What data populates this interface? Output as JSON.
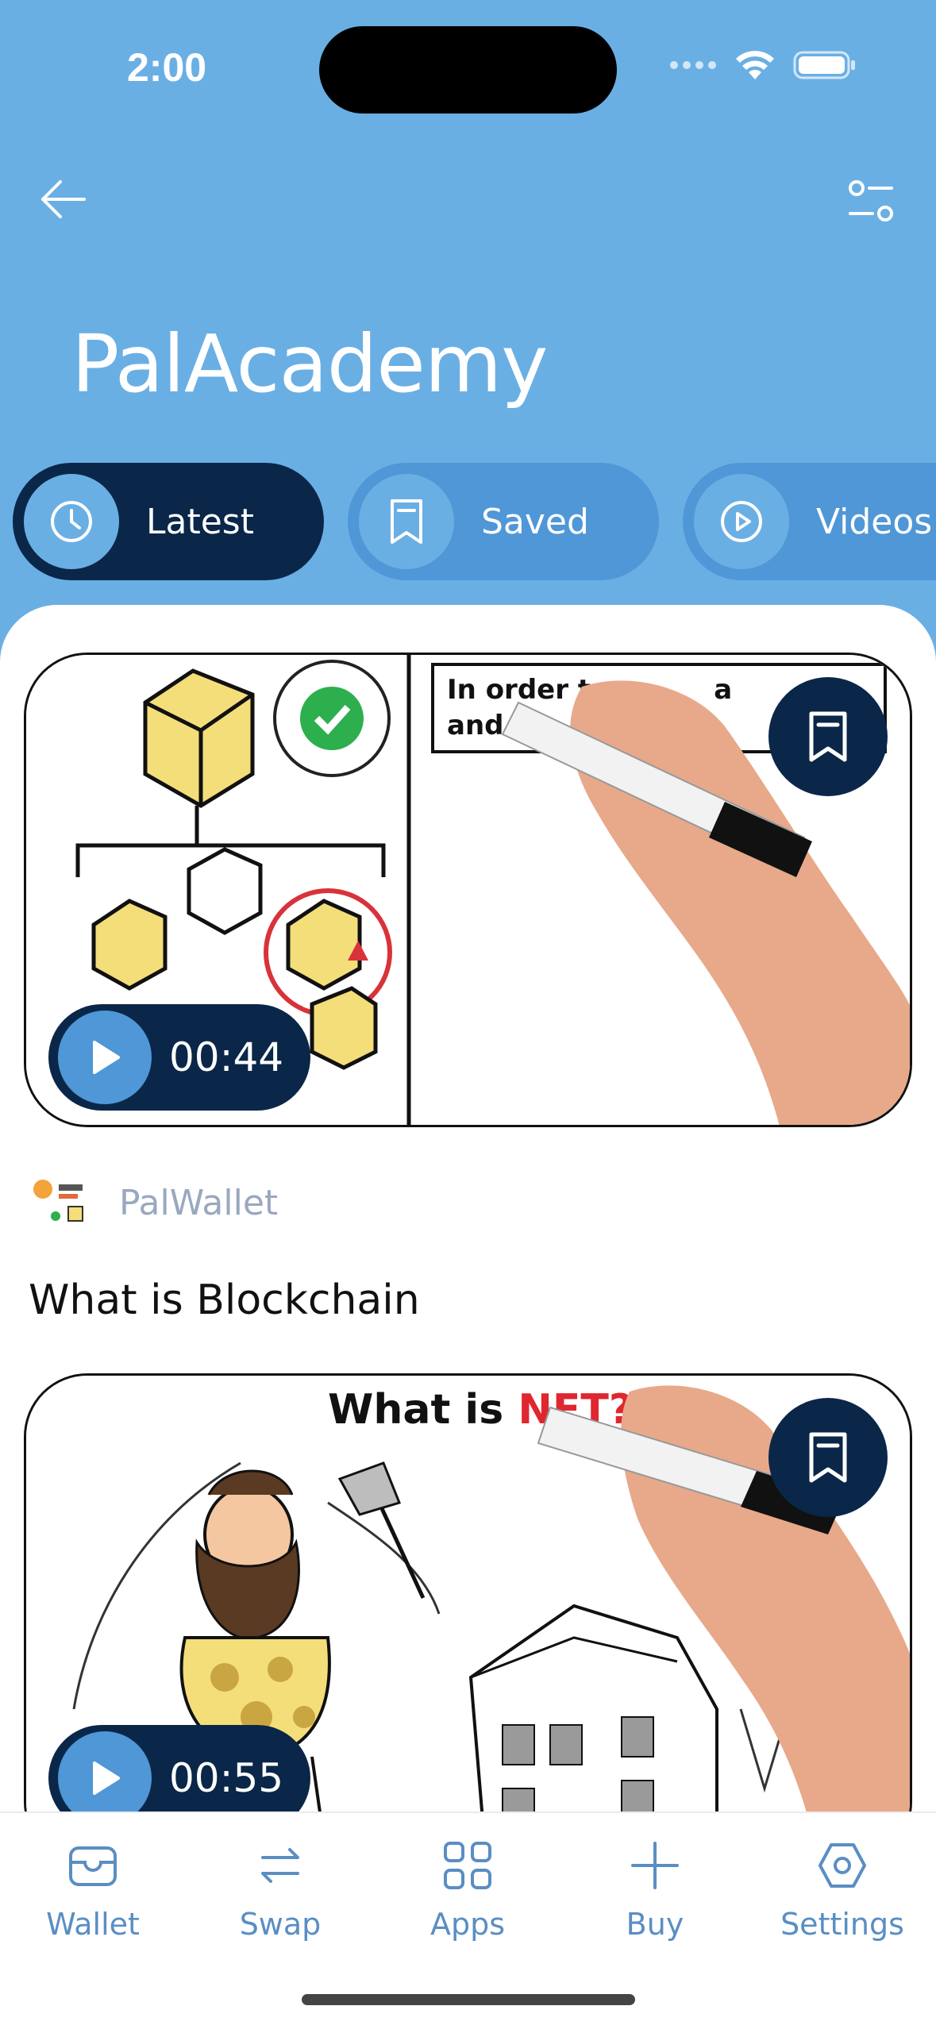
{
  "status_bar": {
    "time": "2:00"
  },
  "header": {
    "title": "PalAcademy",
    "back_icon": "arrow-left-icon",
    "filter_icon": "sliders-icon"
  },
  "tabs": [
    {
      "label": "Latest",
      "icon": "clock-icon",
      "active": true
    },
    {
      "label": "Saved",
      "icon": "bookmark-icon",
      "active": false
    },
    {
      "label": "Videos",
      "icon": "play-circle-icon",
      "active": false
    }
  ],
  "cards": [
    {
      "duration": "00:44",
      "author": "PalWallet",
      "title": "What is Blockchain",
      "thumbnail_text": "In order to change a block and",
      "thumbnail_text_parts": [
        "In order to ",
        "a ",
        "and"
      ]
    },
    {
      "duration": "00:55",
      "thumbnail_title": "What is ",
      "thumbnail_title_accent": "NFT?"
    }
  ],
  "bottom_nav": [
    {
      "label": "Wallet",
      "icon": "wallet-icon"
    },
    {
      "label": "Swap",
      "icon": "swap-icon"
    },
    {
      "label": "Apps",
      "icon": "apps-grid-icon"
    },
    {
      "label": "Buy",
      "icon": "plus-icon"
    },
    {
      "label": "Settings",
      "icon": "settings-hexagon-icon"
    }
  ],
  "colors": {
    "header_bg": "#6AAFE4",
    "navy": "#0A2749",
    "accent_blue": "#4F97D6",
    "nav_text": "#5A8EC3"
  }
}
